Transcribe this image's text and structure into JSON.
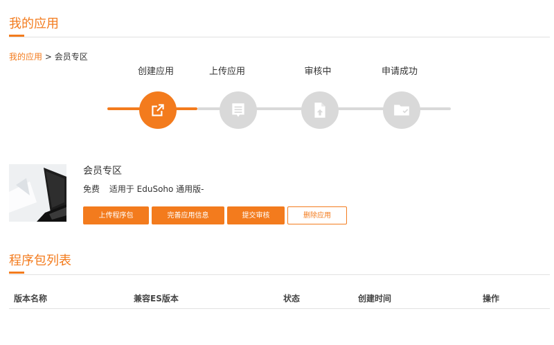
{
  "header": {
    "title": "我的应用"
  },
  "breadcrumb": {
    "parent": "我的应用",
    "separator": ">",
    "current": "会员专区"
  },
  "steps": [
    {
      "label": "创建应用",
      "active": true
    },
    {
      "label": "上传应用",
      "active": false
    },
    {
      "label": "审核中",
      "active": false
    },
    {
      "label": "申请成功",
      "active": false
    }
  ],
  "app": {
    "name": "会员专区",
    "price": "免费",
    "compat": "适用于 EduSoho 通用版-",
    "buttons": {
      "upload": "上传程序包",
      "complete_info": "完善应用信息",
      "submit_review": "提交审核",
      "delete": "删除应用"
    }
  },
  "packages": {
    "title": "程序包列表",
    "columns": [
      "版本名称",
      "兼容ES版本",
      "状态",
      "创建时间",
      "操作"
    ]
  },
  "colors": {
    "accent": "#f37b1d",
    "inactive": "#d9d9d9",
    "divider": "#e1e1e1"
  }
}
